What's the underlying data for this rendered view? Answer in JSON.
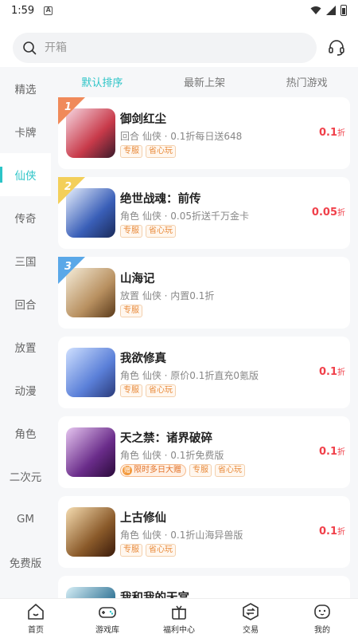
{
  "status": {
    "time": "1:59"
  },
  "search": {
    "placeholder": "开箱"
  },
  "sidebar": {
    "items": [
      {
        "label": "精选"
      },
      {
        "label": "卡牌"
      },
      {
        "label": "仙侠"
      },
      {
        "label": "传奇"
      },
      {
        "label": "三国"
      },
      {
        "label": "回合"
      },
      {
        "label": "放置"
      },
      {
        "label": "动漫"
      },
      {
        "label": "角色"
      },
      {
        "label": "二次元"
      },
      {
        "label": "GM"
      },
      {
        "label": "免费版"
      }
    ],
    "active": "仙侠"
  },
  "tabs": [
    {
      "label": "默认排序"
    },
    {
      "label": "最新上架"
    },
    {
      "label": "热门游戏"
    }
  ],
  "games": [
    {
      "rank": "1",
      "title": "御剑红尘",
      "desc": "回合 仙侠 · 0.1折每日送648",
      "tags": [
        "专服",
        "省心玩"
      ],
      "price": "0.1",
      "unit": "折",
      "thumb_color": "#c83a4a"
    },
    {
      "rank": "2",
      "title": "绝世战魂：前传",
      "desc": "角色 仙侠 · 0.05折送千万金卡",
      "tags": [
        "专服",
        "省心玩"
      ],
      "price": "0.05",
      "unit": "折",
      "thumb_color": "#3a5fb8"
    },
    {
      "rank": "3",
      "title": "山海记",
      "desc": "放置 仙侠 · 内置0.1折",
      "tags": [
        "专服"
      ],
      "price": "",
      "unit": "",
      "thumb_color": "#8a6a3a"
    },
    {
      "rank": "",
      "title": "我欲修真",
      "desc": "角色 仙侠 · 原价0.1折直充0氪版",
      "tags": [
        "专服",
        "省心玩"
      ],
      "price": "0.1",
      "unit": "折",
      "thumb_color": "#5a7fd8"
    },
    {
      "rank": "",
      "title": "天之禁：诸界破碎",
      "desc": "角色 仙侠 · 0.1折免费版",
      "promo": "限时多日大赠",
      "tags": [
        "专服",
        "省心玩"
      ],
      "price": "0.1",
      "unit": "折",
      "thumb_color": "#6a2c8a"
    },
    {
      "rank": "",
      "title": "上古修仙",
      "desc": "角色 仙侠 · 0.1折山海异兽版",
      "tags": [
        "专服",
        "省心玩"
      ],
      "price": "0.1",
      "unit": "折",
      "thumb_color": "#8a5a2a"
    },
    {
      "rank": "",
      "title": "我和我的天宫",
      "desc": "",
      "tags": [],
      "price": "",
      "unit": "",
      "thumb_color": "#3a7a9a"
    }
  ],
  "nav": [
    {
      "label": "首页",
      "icon": "home-icon"
    },
    {
      "label": "游戏库",
      "icon": "gamepad-icon"
    },
    {
      "label": "福利中心",
      "icon": "gift-icon"
    },
    {
      "label": "交易",
      "icon": "exchange-icon"
    },
    {
      "label": "我的",
      "icon": "profile-icon"
    }
  ],
  "colors": {
    "accent": "#2cc4c7",
    "price": "#f0404a",
    "tag": "#e88a3a"
  }
}
